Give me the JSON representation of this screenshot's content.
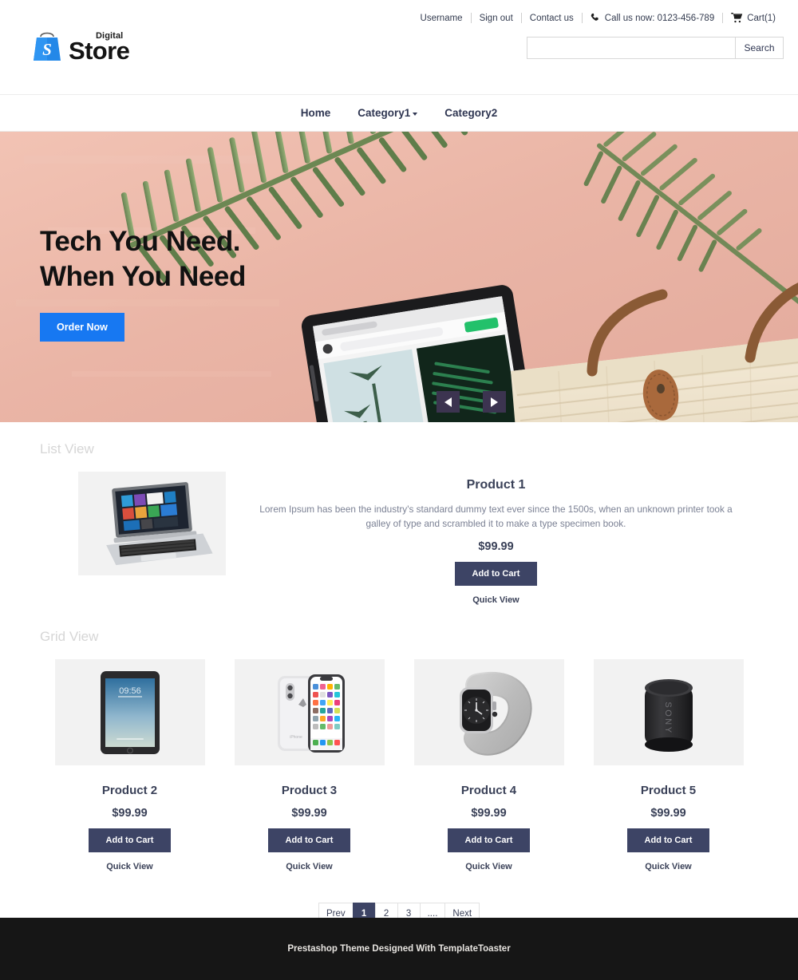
{
  "brand": {
    "logo_icon": "shopping-bag-icon",
    "small_label": "Digital",
    "name": "Store",
    "accent_color": "#1778f2"
  },
  "topbar": {
    "username": "Username",
    "sign_out": "Sign out",
    "contact_us": "Contact us",
    "phone_icon": "phone-icon",
    "phone_text": "Call us now: 0123-456-789",
    "cart_icon": "cart-icon",
    "cart_text": "Cart(1)"
  },
  "search": {
    "value": "",
    "placeholder": "",
    "button_label": "Search"
  },
  "nav": {
    "items": [
      {
        "label": "Home",
        "has_dropdown": false
      },
      {
        "label": "Category1",
        "has_dropdown": true
      },
      {
        "label": "Category2",
        "has_dropdown": false
      }
    ]
  },
  "hero": {
    "title_line1": "Tech You Need.",
    "title_line2": "When You Need",
    "button_label": "Order Now",
    "prev_icon": "arrow-left-icon",
    "next_icon": "arrow-right-icon",
    "image_description": "Samsung tablet and woven straw beach bag on pink background with palm leaves"
  },
  "sections": {
    "list_view_title": "List View",
    "grid_view_title": "Grid View"
  },
  "list_products": [
    {
      "name": "Product 1",
      "description": "Lorem Ipsum has been the industry's standard dummy text ever since the 1500s, when an unknown printer took a galley of type and scrambled it to make a type specimen book.",
      "price": "$99.99",
      "add_to_cart": "Add to Cart",
      "quick_view": "Quick View",
      "image": "laptop-convertible"
    }
  ],
  "grid_products": [
    {
      "name": "Product 2",
      "price": "$99.99",
      "add_to_cart": "Add to Cart",
      "quick_view": "Quick View",
      "image": "tablet"
    },
    {
      "name": "Product 3",
      "price": "$99.99",
      "add_to_cart": "Add to Cart",
      "quick_view": "Quick View",
      "image": "smartphone"
    },
    {
      "name": "Product 4",
      "price": "$99.99",
      "add_to_cart": "Add to Cart",
      "quick_view": "Quick View",
      "image": "smartwatch"
    },
    {
      "name": "Product 5",
      "price": "$99.99",
      "add_to_cart": "Add to Cart",
      "quick_view": "Quick View",
      "image": "speaker"
    }
  ],
  "pagination": {
    "prev": "Prev",
    "pages": [
      "1",
      "2",
      "3",
      "...."
    ],
    "active_page": "1",
    "next": "Next"
  },
  "footer": {
    "text": "Prestashop Theme Designed With TemplateToaster"
  }
}
